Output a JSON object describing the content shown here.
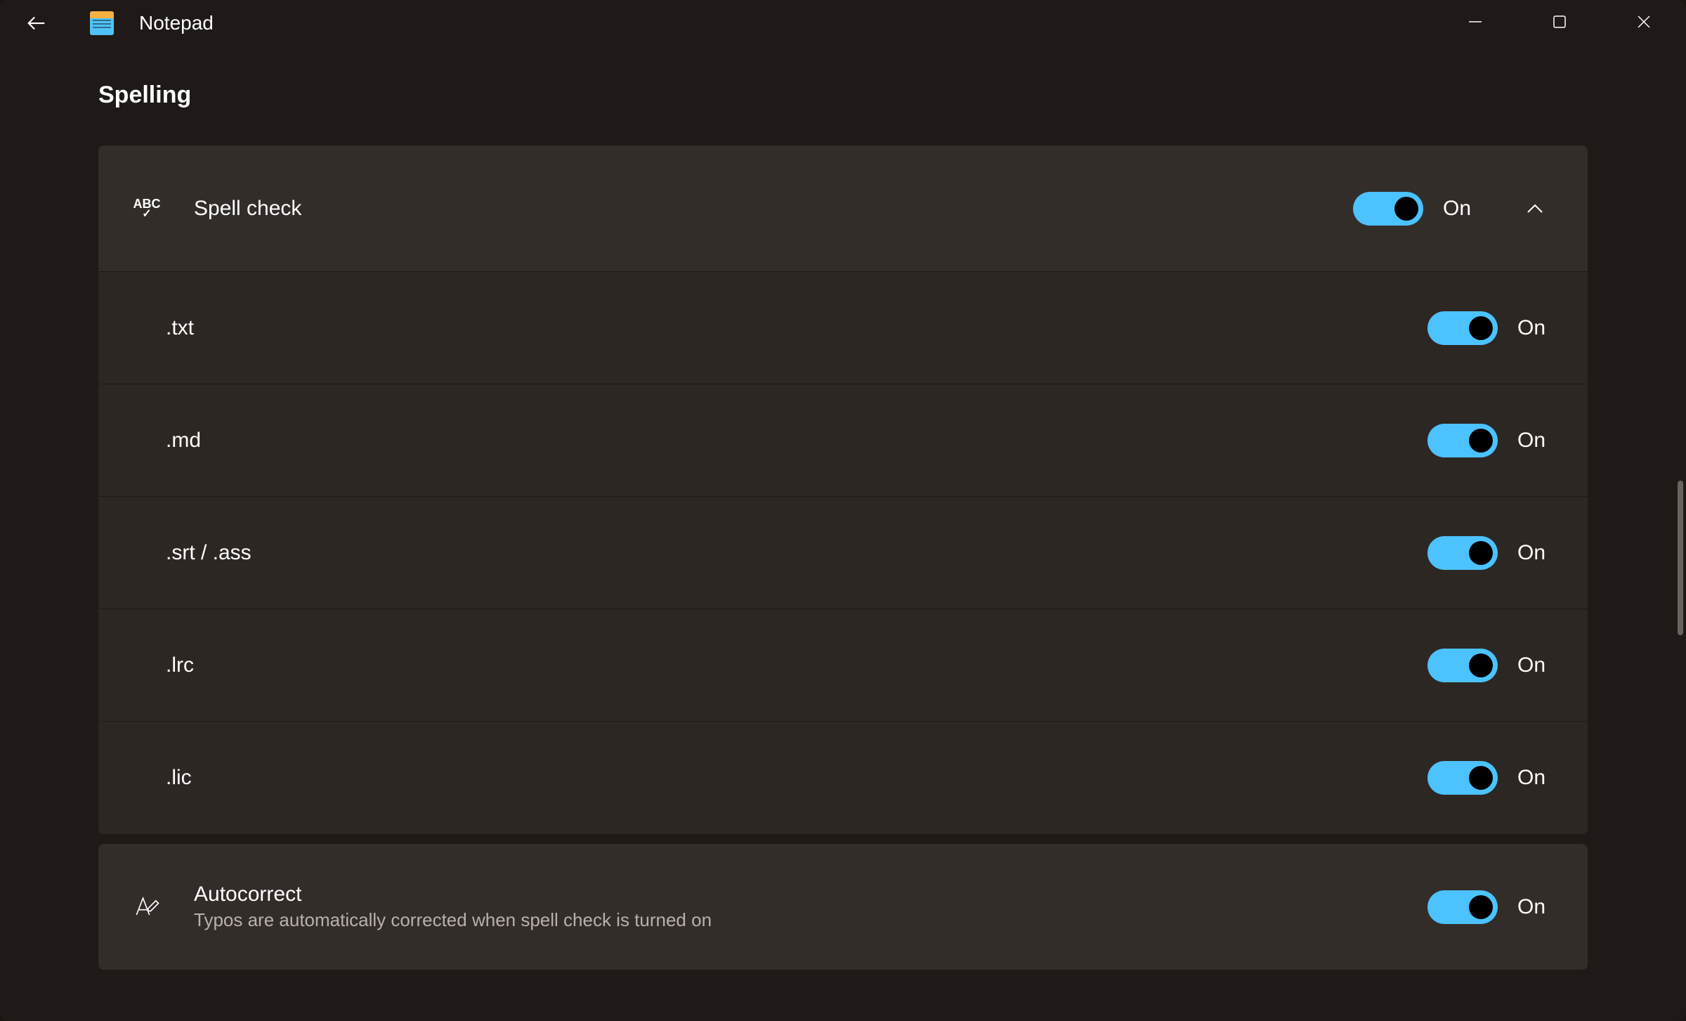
{
  "header": {
    "app_title": "Notepad"
  },
  "section": {
    "title": "Spelling"
  },
  "spell_check": {
    "label": "Spell check",
    "state": "On",
    "items": [
      {
        "label": ".txt",
        "state": "On"
      },
      {
        "label": ".md",
        "state": "On"
      },
      {
        "label": ".srt / .ass",
        "state": "On"
      },
      {
        "label": ".lrc",
        "state": "On"
      },
      {
        "label": ".lic",
        "state": "On"
      }
    ]
  },
  "autocorrect": {
    "label": "Autocorrect",
    "description": "Typos are automatically corrected when spell check is turned on",
    "state": "On"
  }
}
